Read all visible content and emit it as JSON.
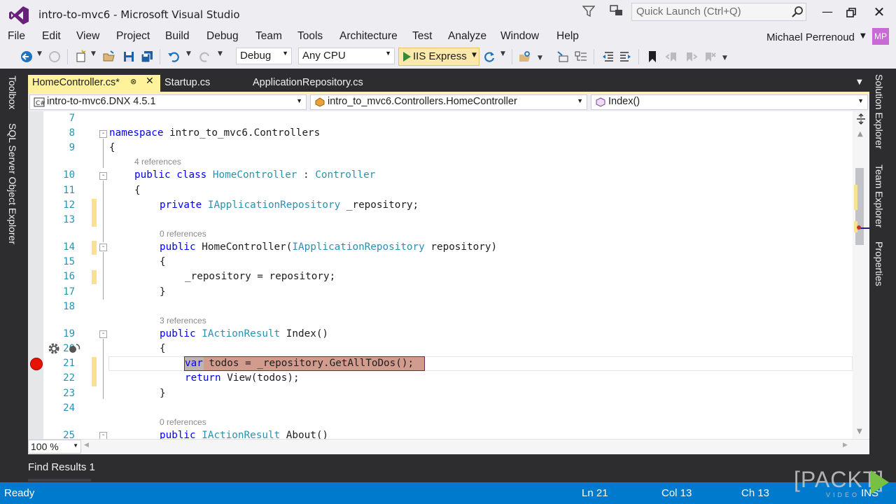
{
  "window": {
    "title": "intro-to-mvc6 - Microsoft Visual Studio",
    "quick_launch_placeholder": "Quick Launch (Ctrl+Q)",
    "user_name": "Michael Perrenoud",
    "user_initials": "MP"
  },
  "menu": {
    "items": [
      "File",
      "Edit",
      "View",
      "Project",
      "Build",
      "Debug",
      "Team",
      "Tools",
      "Architecture",
      "Test",
      "Analyze",
      "Window",
      "Help"
    ]
  },
  "toolbar": {
    "configuration": "Debug",
    "platform": "Any CPU",
    "run_target": "IIS Express"
  },
  "side_tabs": {
    "left": [
      "Toolbox",
      "SQL Server Object Explorer"
    ],
    "right": [
      "Solution Explorer",
      "Team Explorer",
      "Properties"
    ]
  },
  "tabs": [
    {
      "label": "HomeController.cs*",
      "active": true
    },
    {
      "label": "Startup.cs",
      "active": false
    },
    {
      "label": "ApplicationRepository.cs",
      "active": false
    }
  ],
  "nav": {
    "project": "intro-to-mvc6.DNX 4.5.1",
    "type": "intro_to_mvc6.Controllers.HomeController",
    "member": "Index()"
  },
  "code": {
    "line_numbers": [
      "7",
      "8",
      "9",
      "10",
      "11",
      "12",
      "13",
      "14",
      "15",
      "16",
      "17",
      "18",
      "19",
      "20",
      "21",
      "22",
      "23",
      "24",
      "25"
    ],
    "refs": [
      "4 references",
      "0 references",
      "3 references",
      "0 references"
    ],
    "lines": {
      "l8a": "namespace",
      "l8b": " intro_to_mvc6.Controllers",
      "l9": "{",
      "l10a": "public class",
      "l10b": "HomeController",
      "l10c": " : ",
      "l10d": "Controller",
      "l11": "{",
      "l12a": "private",
      "l12b": "IApplicationRepository",
      "l12c": " _repository;",
      "l14a": "public",
      "l14b": " HomeController(",
      "l14c": "IApplicationRepository",
      "l14d": " repository)",
      "l15": "{",
      "l16": "_repository = repository;",
      "l17": "}",
      "l19a": "public",
      "l19b": "IActionResult",
      "l19c": " Index()",
      "l20": "{",
      "l21a": "var",
      "l21b": " todos = _repository.GetAllToDos();",
      "l22a": "return",
      "l22b": " View(todos);",
      "l23": "}",
      "l25a": "public",
      "l25b": "IActionResult",
      "l25c": " About()"
    }
  },
  "editor": {
    "zoom": "100 %"
  },
  "panels": {
    "find_results": "Find Results 1"
  },
  "status": {
    "state": "Ready",
    "line": "Ln 21",
    "col": "Col 13",
    "ch": "Ch 13",
    "mode": "INS"
  },
  "watermark": {
    "brand": "PACKT",
    "sub": "VIDEO"
  },
  "colors": {
    "accent": "#007acc",
    "active_tab": "#fff29d",
    "dark_chrome": "#2d2d30",
    "keyword": "#0000ff",
    "type": "#2b91af",
    "breakpoint": "#e51400"
  }
}
